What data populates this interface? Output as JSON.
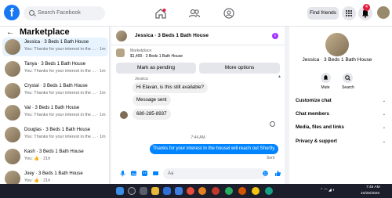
{
  "header": {
    "logo": "f",
    "search_placeholder": "Search Facebook",
    "find_friends": "Find friends",
    "notification_count": "4"
  },
  "sidebar": {
    "title": "Marketplace",
    "conversations": [
      {
        "name": "Jessica · 3 Beds 1 Bath House",
        "preview": "You: Thanks for your interest in the ... · 1m",
        "active": true
      },
      {
        "name": "Tanya · 3 Beds 1 Bath House",
        "preview": "You: Thanks for your interest in the ... · 1m"
      },
      {
        "name": "Crystal · 3 Beds 1 Bath House",
        "preview": "You: Thanks for your interest in the ... · 1m"
      },
      {
        "name": "Val · 3 Beds 1 Bath House",
        "preview": "You: Thanks for your interest in the ... · 1m"
      },
      {
        "name": "Douglas · 3 Beds 1 Bath House",
        "preview": "You: Thanks for your interest in the ... · 1m"
      },
      {
        "name": "Kash · 3 Beds 1 Bath House",
        "preview": "You: 👍 · 21h"
      },
      {
        "name": "Joey · 3 Beds 1 Bath House",
        "preview": "You: 👍 · 21h"
      }
    ]
  },
  "chat": {
    "title": "Jessica · 3 Beds 1 Bath House",
    "listing_label": "Marketplace",
    "listing_price": "$1,400 · 3 Beds 1 Bath House",
    "mark_pending": "Mark as pending",
    "more_options": "More options",
    "sender_label": "Jessica",
    "messages_in": [
      "Hi Elavan, is this still available?",
      "Message sent",
      "680-285-8937"
    ],
    "time": "7:44 AM",
    "message_out": "Thanks for your interest in the housel will reach out Shortly.",
    "sent_label": "Sent",
    "composer_placeholder": "Aa"
  },
  "details": {
    "name": "Jessica · 3 Beds 1 Bath House",
    "mute": "Mute",
    "search": "Search",
    "menu": [
      "Customize chat",
      "Chat members",
      "Media, files and links",
      "Privacy & support"
    ]
  },
  "taskbar": {
    "time": "7:45 AM",
    "date": "10/25/2025"
  },
  "colors": {
    "accent": "#1877f2",
    "outgoing_bubble": "#0084ff",
    "badge": "#e41e3f"
  }
}
